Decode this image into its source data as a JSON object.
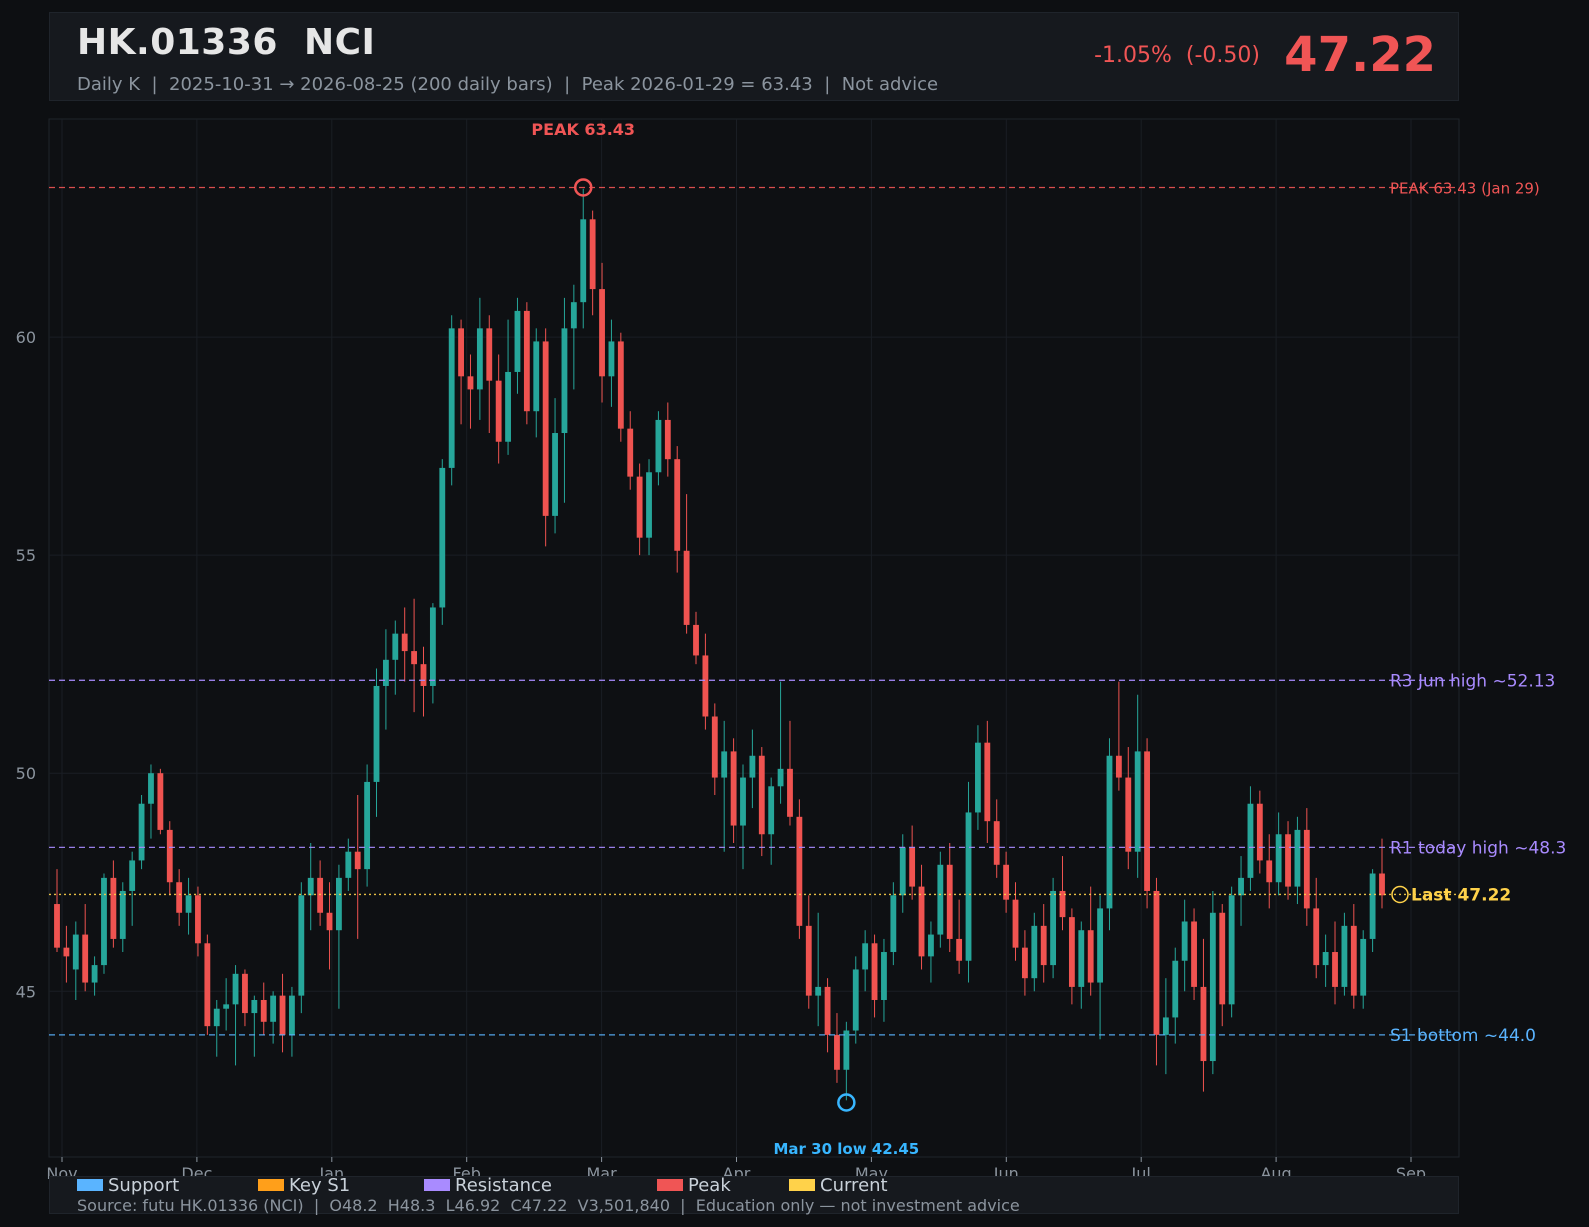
{
  "header": {
    "title": "HK.01336  NCI",
    "subtitle": "Daily K  |  2025-10-31 → 2026-08-25 (200 daily bars)  |  Peak 2026-01-29 = 63.43  |  Not advice",
    "change": "-1.05%  (-0.50)",
    "price": "47.22",
    "change_color": "#f05555"
  },
  "legend": [
    {
      "label": "Support",
      "color": "#5ab4ff"
    },
    {
      "label": "Key S1",
      "color": "#ff9f1a"
    },
    {
      "label": "Resistance",
      "color": "#a98bff"
    },
    {
      "label": "Peak",
      "color": "#f05555"
    },
    {
      "label": "Current",
      "color": "#ffd24a"
    }
  ],
  "footer": {
    "source": "Source: futu HK.01336 (NCI)  |  O48.2  H48.3  L46.92  C47.22  V3,501,840  |  Education only — not investment advice"
  },
  "chart_data": {
    "type": "candlestick",
    "x_ticks": [
      "Nov",
      "Dec",
      "Jan",
      "Feb",
      "Mar",
      "Apr",
      "May",
      "Jun",
      "Jul",
      "Aug",
      "Sep"
    ],
    "y_ticks": [
      45,
      50,
      55,
      60
    ],
    "ylim": [
      41.2,
      65
    ],
    "up_color": "#26a69a",
    "down_color": "#ef5350",
    "hlines": [
      {
        "label": "PEAK 63.43 (Jan 29)",
        "value": 63.43,
        "color": "#f05555",
        "style": "dashed"
      },
      {
        "label": "R3 Jun high ~52.13",
        "value": 52.13,
        "color": "#a98bff",
        "style": "dashed"
      },
      {
        "label": "R1 today high ~48.3",
        "value": 48.3,
        "color": "#a98bff",
        "style": "dashed"
      },
      {
        "label": "Last 47.22",
        "value": 47.22,
        "color": "#ffd24a",
        "style": "dotted"
      },
      {
        "label": "S1 bottom ~44.0",
        "value": 44.0,
        "color": "#5ab4ff",
        "style": "dashed"
      }
    ],
    "annotations": [
      {
        "label": "PEAK 63.43",
        "date": "2026-01-29",
        "value": 63.43,
        "color": "#f05555"
      },
      {
        "label": "Mar 30 low 42.45",
        "date": "2026-03-30",
        "value": 42.45,
        "color": "#38b6ff"
      }
    ],
    "ohlc_approx": [
      [
        47.0,
        47.8,
        45.9,
        46.0
      ],
      [
        46.0,
        46.5,
        45.2,
        45.8
      ],
      [
        45.5,
        46.6,
        44.8,
        46.3
      ],
      [
        46.3,
        47.0,
        45.0,
        45.2
      ],
      [
        45.2,
        45.8,
        44.9,
        45.6
      ],
      [
        45.6,
        47.7,
        45.4,
        47.6
      ],
      [
        47.6,
        48.0,
        46.0,
        46.2
      ],
      [
        46.2,
        47.5,
        45.9,
        47.3
      ],
      [
        47.3,
        48.2,
        46.5,
        48.0
      ],
      [
        48.0,
        49.5,
        47.8,
        49.3
      ],
      [
        49.3,
        50.2,
        48.5,
        50.0
      ],
      [
        50.0,
        50.1,
        48.6,
        48.7
      ],
      [
        48.7,
        48.9,
        47.2,
        47.5
      ],
      [
        47.5,
        47.8,
        46.5,
        46.8
      ],
      [
        46.8,
        47.6,
        46.3,
        47.2
      ],
      [
        47.2,
        47.4,
        45.8,
        46.1
      ],
      [
        46.1,
        46.3,
        44.0,
        44.2
      ],
      [
        44.2,
        44.8,
        43.5,
        44.6
      ],
      [
        44.6,
        45.3,
        44.1,
        44.7
      ],
      [
        44.7,
        45.6,
        43.3,
        45.4
      ],
      [
        45.4,
        45.5,
        44.2,
        44.5
      ],
      [
        44.5,
        44.9,
        43.5,
        44.8
      ],
      [
        44.8,
        45.2,
        44.0,
        44.3
      ],
      [
        44.3,
        45.0,
        43.8,
        44.9
      ],
      [
        44.9,
        45.4,
        43.6,
        44.0
      ],
      [
        44.0,
        45.1,
        43.5,
        44.9
      ],
      [
        44.9,
        47.5,
        44.5,
        47.2
      ],
      [
        47.2,
        48.4,
        46.4,
        47.6
      ],
      [
        47.6,
        48.0,
        46.5,
        46.8
      ],
      [
        46.8,
        47.5,
        45.5,
        46.4
      ],
      [
        46.4,
        47.9,
        44.6,
        47.6
      ],
      [
        47.6,
        48.5,
        47.3,
        48.2
      ],
      [
        48.2,
        49.5,
        46.2,
        47.8
      ],
      [
        47.8,
        50.2,
        47.4,
        49.8
      ],
      [
        49.8,
        52.4,
        49.0,
        52.0
      ],
      [
        52.0,
        53.3,
        51.0,
        52.6
      ],
      [
        52.6,
        53.5,
        51.8,
        53.2
      ],
      [
        53.2,
        53.8,
        52.1,
        52.8
      ],
      [
        52.8,
        54.0,
        51.4,
        52.5
      ],
      [
        52.5,
        52.9,
        51.3,
        52.0
      ],
      [
        52.0,
        53.9,
        51.6,
        53.8
      ],
      [
        53.8,
        57.2,
        53.4,
        57.0
      ],
      [
        57.0,
        60.5,
        56.6,
        60.2
      ],
      [
        60.2,
        60.4,
        58.0,
        59.1
      ],
      [
        59.1,
        59.6,
        57.9,
        58.8
      ],
      [
        58.8,
        60.9,
        58.1,
        60.2
      ],
      [
        60.2,
        60.5,
        57.8,
        59.0
      ],
      [
        59.0,
        59.6,
        57.1,
        57.6
      ],
      [
        57.6,
        60.4,
        57.3,
        59.2
      ],
      [
        59.2,
        60.9,
        58.7,
        60.6
      ],
      [
        60.6,
        60.8,
        58.0,
        58.3
      ],
      [
        58.3,
        60.2,
        57.7,
        59.9
      ],
      [
        59.9,
        60.2,
        55.2,
        55.9
      ],
      [
        55.9,
        58.6,
        55.5,
        57.8
      ],
      [
        57.8,
        60.9,
        56.2,
        60.2
      ],
      [
        60.2,
        61.2,
        58.8,
        60.8
      ],
      [
        60.8,
        63.4,
        60.2,
        62.7
      ],
      [
        62.7,
        62.9,
        60.5,
        61.1
      ],
      [
        61.1,
        61.7,
        58.5,
        59.1
      ],
      [
        59.1,
        60.4,
        58.4,
        59.9
      ],
      [
        59.9,
        60.1,
        57.6,
        57.9
      ],
      [
        57.9,
        58.3,
        56.5,
        56.8
      ],
      [
        56.8,
        57.1,
        55.0,
        55.4
      ],
      [
        55.4,
        57.2,
        55.0,
        56.9
      ],
      [
        56.9,
        58.3,
        56.6,
        58.1
      ],
      [
        58.1,
        58.5,
        56.8,
        57.2
      ],
      [
        57.2,
        57.5,
        54.6,
        55.1
      ],
      [
        55.1,
        56.4,
        53.2,
        53.4
      ],
      [
        53.4,
        53.7,
        52.5,
        52.7
      ],
      [
        52.7,
        53.2,
        51.0,
        51.3
      ],
      [
        51.3,
        51.6,
        49.5,
        49.9
      ],
      [
        49.9,
        51.2,
        48.2,
        50.5
      ],
      [
        50.5,
        50.8,
        48.4,
        48.8
      ],
      [
        48.8,
        50.2,
        47.8,
        49.9
      ],
      [
        49.9,
        51.0,
        49.2,
        50.4
      ],
      [
        50.4,
        50.6,
        48.1,
        48.6
      ],
      [
        48.6,
        49.9,
        47.9,
        49.7
      ],
      [
        49.7,
        52.1,
        49.3,
        50.1
      ],
      [
        50.1,
        51.2,
        48.8,
        49.0
      ],
      [
        49.0,
        49.4,
        46.2,
        46.5
      ],
      [
        46.5,
        47.2,
        44.6,
        44.9
      ],
      [
        44.9,
        46.8,
        44.2,
        45.1
      ],
      [
        45.1,
        45.3,
        43.6,
        44.0
      ],
      [
        44.0,
        44.5,
        42.9,
        43.2
      ],
      [
        43.2,
        44.3,
        42.5,
        44.1
      ],
      [
        44.1,
        45.8,
        43.8,
        45.5
      ],
      [
        45.5,
        46.4,
        45.0,
        46.1
      ],
      [
        46.1,
        46.3,
        44.4,
        44.8
      ],
      [
        44.8,
        46.2,
        44.3,
        45.9
      ],
      [
        45.9,
        47.5,
        45.6,
        47.2
      ],
      [
        47.2,
        48.6,
        46.8,
        48.3
      ],
      [
        48.3,
        48.8,
        47.1,
        47.4
      ],
      [
        47.4,
        47.9,
        45.5,
        45.8
      ],
      [
        45.8,
        46.6,
        45.2,
        46.3
      ],
      [
        46.3,
        48.2,
        46.0,
        47.9
      ],
      [
        47.9,
        48.4,
        45.9,
        46.2
      ],
      [
        46.2,
        47.1,
        45.4,
        45.7
      ],
      [
        45.7,
        49.8,
        45.2,
        49.1
      ],
      [
        49.1,
        51.1,
        48.7,
        50.7
      ],
      [
        50.7,
        51.2,
        48.4,
        48.9
      ],
      [
        48.9,
        49.4,
        47.6,
        47.9
      ],
      [
        47.9,
        48.2,
        46.8,
        47.1
      ],
      [
        47.1,
        47.5,
        45.7,
        46.0
      ],
      [
        46.0,
        46.4,
        44.9,
        45.3
      ],
      [
        45.3,
        46.8,
        45.0,
        46.5
      ],
      [
        46.5,
        47.0,
        45.2,
        45.6
      ],
      [
        45.6,
        47.6,
        45.3,
        47.3
      ],
      [
        47.3,
        48.1,
        46.4,
        46.7
      ],
      [
        46.7,
        46.9,
        44.7,
        45.1
      ],
      [
        45.1,
        46.6,
        44.6,
        46.4
      ],
      [
        46.4,
        47.4,
        44.9,
        45.2
      ],
      [
        45.2,
        47.2,
        43.9,
        46.9
      ],
      [
        46.9,
        50.8,
        46.4,
        50.4
      ],
      [
        50.4,
        52.1,
        49.6,
        49.9
      ],
      [
        49.9,
        50.6,
        47.8,
        48.2
      ],
      [
        48.2,
        51.8,
        47.6,
        50.5
      ],
      [
        50.5,
        50.8,
        46.9,
        47.3
      ],
      [
        47.3,
        47.6,
        43.3,
        44.0
      ],
      [
        44.0,
        45.3,
        43.1,
        44.4
      ],
      [
        44.4,
        46.0,
        43.8,
        45.7
      ],
      [
        45.7,
        47.1,
        45.0,
        46.6
      ],
      [
        46.6,
        46.9,
        44.8,
        45.1
      ],
      [
        45.1,
        46.2,
        42.7,
        43.4
      ],
      [
        43.4,
        47.3,
        43.1,
        46.8
      ],
      [
        46.8,
        47.0,
        44.2,
        44.7
      ],
      [
        44.7,
        47.4,
        44.4,
        47.2
      ],
      [
        47.2,
        48.1,
        46.5,
        47.6
      ],
      [
        47.6,
        49.7,
        47.3,
        49.3
      ],
      [
        49.3,
        49.6,
        47.7,
        48.0
      ],
      [
        48.0,
        48.6,
        46.9,
        47.5
      ],
      [
        47.5,
        49.1,
        47.2,
        48.6
      ],
      [
        48.6,
        48.9,
        47.1,
        47.4
      ],
      [
        47.4,
        49.0,
        47.0,
        48.7
      ],
      [
        48.7,
        49.2,
        46.5,
        46.9
      ],
      [
        46.9,
        47.6,
        45.3,
        45.6
      ],
      [
        45.6,
        46.3,
        45.1,
        45.9
      ],
      [
        45.9,
        46.6,
        44.7,
        45.1
      ],
      [
        45.1,
        46.8,
        44.9,
        46.5
      ],
      [
        46.5,
        47.0,
        44.6,
        44.9
      ],
      [
        44.9,
        46.4,
        44.6,
        46.2
      ],
      [
        46.2,
        47.8,
        45.9,
        47.7
      ],
      [
        47.7,
        48.5,
        46.9,
        47.2
      ]
    ]
  }
}
